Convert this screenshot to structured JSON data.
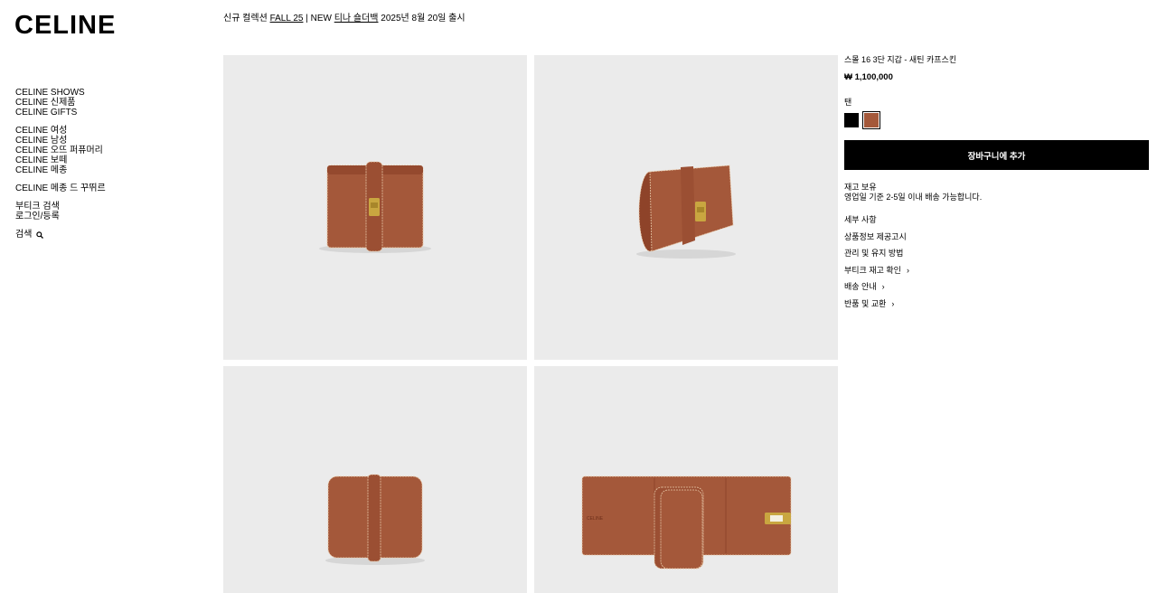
{
  "brand": {
    "logo": "CELINE"
  },
  "announcement": {
    "prefix": "신규 컬렉션 ",
    "fall_link": "FALL 25",
    "mid": " | NEW ",
    "bag_link": "티나 숄더백",
    "suffix": " 2025년 8월 20일 출시"
  },
  "nav": {
    "group1": [
      "CELINE SHOWS",
      "CELINE 신제품",
      "CELINE GIFTS"
    ],
    "group2": [
      "CELINE 여성",
      "CELINE 남성",
      "CELINE 오뜨 퍼퓨머리",
      "CELINE 보떼",
      "CELINE 메종"
    ],
    "group3": [
      "CELINE 메종 드 꾸뛰르"
    ],
    "group4": [
      "부티크 검색",
      "로그인/등록"
    ],
    "search_label": "검색"
  },
  "product": {
    "name": "스몰 16 3단 지갑 - 새틴 카프스킨",
    "price": "₩ 1,100,000",
    "color_label": "탠",
    "swatches": [
      {
        "name": "black",
        "hex": "#000000"
      },
      {
        "name": "tan",
        "hex": "#a4583a"
      }
    ],
    "cart_button": "장바구니에 추가",
    "stock_status": "재고 보유",
    "delivery_note": "영업일 기준 2-5일 이내 배송 가능합니다.",
    "details": [
      "세부 사항",
      "상품정보 제공고시",
      "관리 및 유지 방법"
    ],
    "links": [
      "부티크 재고 확인",
      "배송 안내",
      "반품 및 교환"
    ]
  },
  "colors": {
    "leather": "#a4583a",
    "gallery_bg": "#ebebeb",
    "button_bg": "#000000",
    "hardware": "#c9a640"
  }
}
